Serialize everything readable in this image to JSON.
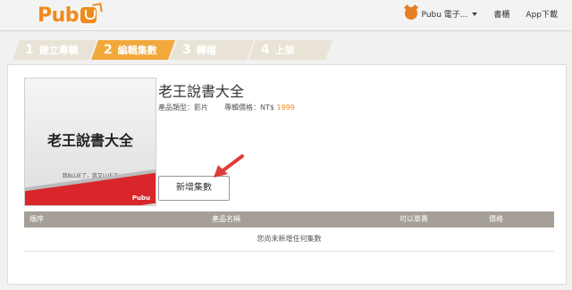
{
  "header": {
    "logo_text": "Pub",
    "user_label": "Pubu 電子...",
    "bookshelf_label": "書櫃",
    "app_download_label": "App下載"
  },
  "steps": [
    {
      "num": "1",
      "label": "建立專輯",
      "active": false
    },
    {
      "num": "2",
      "label": "編輯集數",
      "active": true
    },
    {
      "num": "3",
      "label": "轉檔",
      "active": false
    },
    {
      "num": "4",
      "label": "上架",
      "active": false
    }
  ],
  "product": {
    "cover_title": "老王說書大全",
    "cover_subtitle": "我BLUE了，我又LUE了",
    "cover_logo": "Pubu",
    "title": "老王說書大全",
    "type_label": "產品類型：",
    "type_value": "影片",
    "price_label": "專輯價格：",
    "price_currency": "NT$",
    "price_value": "1999"
  },
  "add_button_label": "新增集數",
  "table": {
    "columns": [
      "順序",
      "產品名稱",
      "可以單賣",
      "價格"
    ],
    "empty_message": "您尚未新增任何集數"
  },
  "colors": {
    "accent": "#f08a1c",
    "step_active": "#f2a93b",
    "step_inactive": "#e8e3d6",
    "table_header": "#a59f97",
    "arrow": "#e03c3c"
  }
}
